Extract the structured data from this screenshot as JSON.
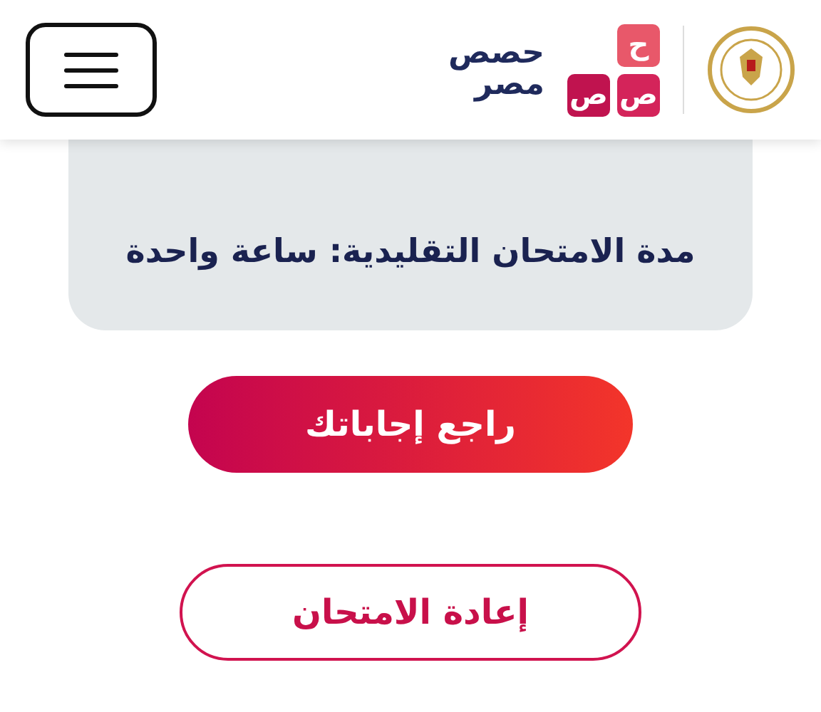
{
  "header": {
    "logo_tiles": [
      "ح",
      "ص",
      "ص"
    ],
    "logo_text": [
      "حصص",
      "مصر"
    ]
  },
  "info_card": {
    "text": "مدة الامتحان التقليدية: ساعة واحدة"
  },
  "buttons": [
    {
      "kind": "filled",
      "label": "راجع إجاباتك"
    },
    {
      "kind": "outline",
      "label": "إعادة الامتحان"
    }
  ]
}
